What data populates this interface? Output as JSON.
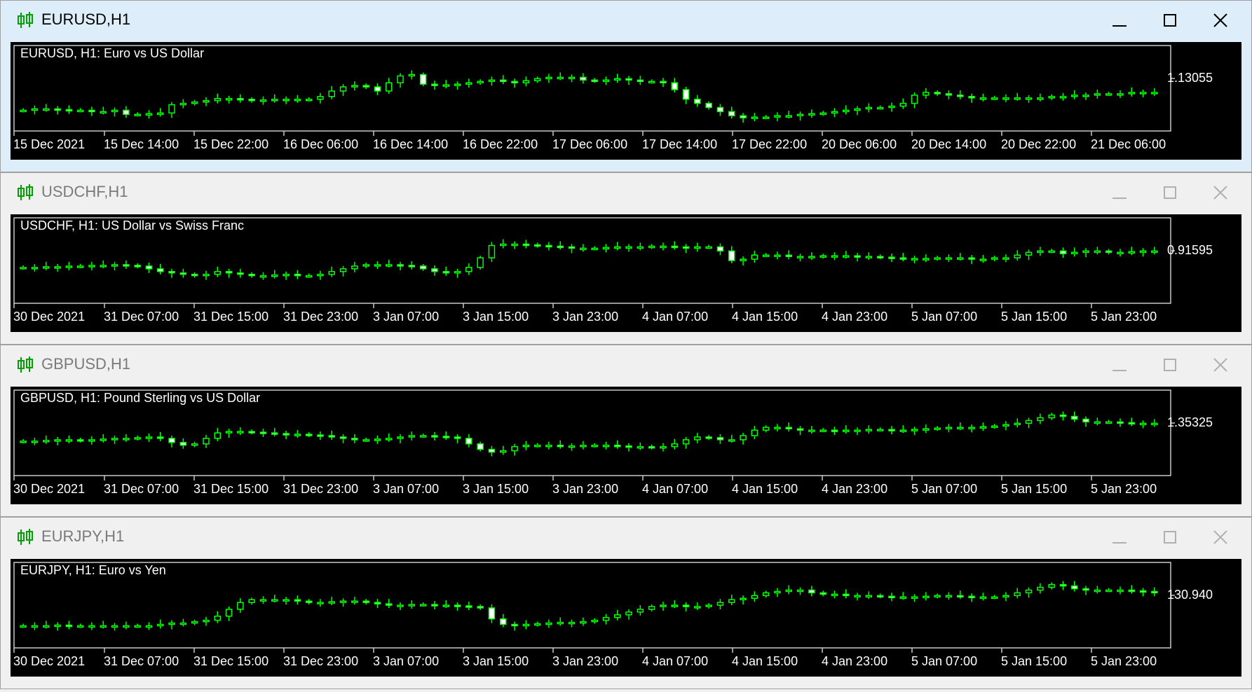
{
  "accent_candle_color": "#00ff00",
  "background_color": "#000000",
  "windows": [
    {
      "title": "EURUSD,H1",
      "active": true,
      "symbol_label": "EURUSD, H1:  Euro vs US Dollar",
      "price_label": "1.13055",
      "time_labels": [
        "15 Dec 2021",
        "15 Dec 14:00",
        "15 Dec 22:00",
        "16 Dec 06:00",
        "16 Dec 14:00",
        "16 Dec 22:00",
        "17 Dec 06:00",
        "17 Dec 14:00",
        "17 Dec 22:00",
        "20 Dec 06:00",
        "20 Dec 14:00",
        "20 Dec 22:00",
        "21 Dec 06:00"
      ],
      "controls": [
        "minimize-icon",
        "maximize-icon",
        "close-icon"
      ],
      "chart_data": {
        "type": "candlestick",
        "series_shape": [
          0.2,
          0.22,
          0.22,
          0.21,
          0.2,
          0.2,
          0.18,
          0.18,
          0.2,
          0.14,
          0.14,
          0.15,
          0.16,
          0.28,
          0.3,
          0.32,
          0.34,
          0.37,
          0.37,
          0.36,
          0.34,
          0.35,
          0.36,
          0.36,
          0.36,
          0.36,
          0.4,
          0.48,
          0.54,
          0.56,
          0.54,
          0.48,
          0.6,
          0.7,
          0.72,
          0.58,
          0.56,
          0.57,
          0.58,
          0.6,
          0.62,
          0.64,
          0.62,
          0.6,
          0.63,
          0.66,
          0.68,
          0.68,
          0.68,
          0.64,
          0.63,
          0.64,
          0.66,
          0.64,
          0.62,
          0.62,
          0.6,
          0.5,
          0.36,
          0.3,
          0.24,
          0.18,
          0.12,
          0.09,
          0.1,
          0.1,
          0.12,
          0.12,
          0.14,
          0.15,
          0.16,
          0.18,
          0.2,
          0.22,
          0.24,
          0.24,
          0.26,
          0.3,
          0.42,
          0.46,
          0.44,
          0.42,
          0.4,
          0.38,
          0.38,
          0.38,
          0.38,
          0.38,
          0.38,
          0.38,
          0.4,
          0.4,
          0.42,
          0.42,
          0.44,
          0.44,
          0.44,
          0.46,
          0.46,
          0.46
        ],
        "price_marker": "1.13055"
      }
    },
    {
      "title": "USDCHF,H1",
      "active": false,
      "symbol_label": "USDCHF, H1:  US Dollar vs Swiss Franc",
      "price_label": "0.91595",
      "time_labels": [
        "30 Dec 2021",
        "31 Dec 07:00",
        "31 Dec 15:00",
        "31 Dec 23:00",
        "3 Jan 07:00",
        "3 Jan 15:00",
        "3 Jan 23:00",
        "4 Jan 07:00",
        "4 Jan 15:00",
        "4 Jan 23:00",
        "5 Jan 07:00",
        "5 Jan 15:00",
        "5 Jan 23:00"
      ],
      "controls": [
        "minimize-icon",
        "maximize-icon",
        "close-icon"
      ],
      "chart_data": {
        "type": "candlestick",
        "series_shape": [
          0.42,
          0.42,
          0.43,
          0.43,
          0.44,
          0.44,
          0.45,
          0.45,
          0.46,
          0.45,
          0.44,
          0.4,
          0.36,
          0.34,
          0.32,
          0.3,
          0.32,
          0.36,
          0.34,
          0.32,
          0.3,
          0.3,
          0.31,
          0.32,
          0.3,
          0.3,
          0.32,
          0.36,
          0.4,
          0.44,
          0.46,
          0.46,
          0.46,
          0.45,
          0.44,
          0.4,
          0.36,
          0.34,
          0.36,
          0.42,
          0.56,
          0.74,
          0.76,
          0.76,
          0.75,
          0.74,
          0.73,
          0.72,
          0.7,
          0.7,
          0.7,
          0.71,
          0.72,
          0.72,
          0.72,
          0.73,
          0.73,
          0.72,
          0.7,
          0.72,
          0.72,
          0.66,
          0.52,
          0.54,
          0.6,
          0.6,
          0.6,
          0.58,
          0.58,
          0.58,
          0.59,
          0.59,
          0.59,
          0.58,
          0.58,
          0.57,
          0.56,
          0.55,
          0.55,
          0.55,
          0.56,
          0.56,
          0.56,
          0.54,
          0.54,
          0.56,
          0.56,
          0.6,
          0.64,
          0.66,
          0.66,
          0.62,
          0.64,
          0.66,
          0.66,
          0.64,
          0.64,
          0.65,
          0.66,
          0.66
        ],
        "price_marker": "0.91595"
      }
    },
    {
      "title": "GBPUSD,H1",
      "active": false,
      "symbol_label": "GBPUSD, H1:  Pound Sterling vs US Dollar",
      "price_label": "1.35325",
      "time_labels": [
        "30 Dec 2021",
        "31 Dec 07:00",
        "31 Dec 15:00",
        "31 Dec 23:00",
        "3 Jan 07:00",
        "3 Jan 15:00",
        "3 Jan 23:00",
        "4 Jan 07:00",
        "4 Jan 15:00",
        "4 Jan 23:00",
        "5 Jan 07:00",
        "5 Jan 15:00",
        "5 Jan 23:00"
      ],
      "controls": [
        "minimize-icon",
        "maximize-icon",
        "close-icon"
      ],
      "chart_data": {
        "type": "candlestick",
        "series_shape": [
          0.4,
          0.4,
          0.41,
          0.42,
          0.42,
          0.41,
          0.42,
          0.43,
          0.44,
          0.44,
          0.45,
          0.46,
          0.44,
          0.38,
          0.34,
          0.36,
          0.44,
          0.52,
          0.54,
          0.54,
          0.53,
          0.52,
          0.51,
          0.5,
          0.5,
          0.49,
          0.48,
          0.46,
          0.44,
          0.42,
          0.42,
          0.43,
          0.44,
          0.46,
          0.48,
          0.48,
          0.47,
          0.46,
          0.44,
          0.36,
          0.28,
          0.24,
          0.26,
          0.32,
          0.34,
          0.34,
          0.34,
          0.33,
          0.33,
          0.34,
          0.34,
          0.34,
          0.33,
          0.32,
          0.32,
          0.31,
          0.32,
          0.36,
          0.42,
          0.46,
          0.45,
          0.42,
          0.42,
          0.48,
          0.56,
          0.6,
          0.6,
          0.58,
          0.56,
          0.56,
          0.56,
          0.55,
          0.56,
          0.56,
          0.57,
          0.57,
          0.56,
          0.56,
          0.57,
          0.58,
          0.59,
          0.6,
          0.6,
          0.6,
          0.61,
          0.62,
          0.64,
          0.66,
          0.7,
          0.74,
          0.78,
          0.76,
          0.72,
          0.68,
          0.68,
          0.68,
          0.67,
          0.66,
          0.66,
          0.66
        ],
        "price_marker": "1.35325"
      }
    },
    {
      "title": "EURJPY,H1",
      "active": false,
      "symbol_label": "EURJPY, H1:  Euro vs Yen",
      "price_label": "130.940",
      "time_labels": [
        "30 Dec 2021",
        "31 Dec 07:00",
        "31 Dec 15:00",
        "31 Dec 23:00",
        "3 Jan 07:00",
        "3 Jan 15:00",
        "3 Jan 23:00",
        "4 Jan 07:00",
        "4 Jan 15:00",
        "4 Jan 23:00",
        "5 Jan 07:00",
        "5 Jan 15:00",
        "5 Jan 23:00"
      ],
      "controls": [
        "minimize-icon",
        "maximize-icon",
        "close-icon"
      ],
      "chart_data": {
        "type": "candlestick",
        "series_shape": [
          0.22,
          0.22,
          0.22,
          0.23,
          0.22,
          0.22,
          0.22,
          0.22,
          0.22,
          0.22,
          0.22,
          0.22,
          0.24,
          0.26,
          0.26,
          0.28,
          0.3,
          0.36,
          0.46,
          0.56,
          0.6,
          0.6,
          0.6,
          0.6,
          0.58,
          0.56,
          0.56,
          0.57,
          0.58,
          0.58,
          0.56,
          0.54,
          0.52,
          0.52,
          0.53,
          0.53,
          0.52,
          0.52,
          0.51,
          0.5,
          0.48,
          0.32,
          0.24,
          0.22,
          0.24,
          0.25,
          0.26,
          0.27,
          0.27,
          0.28,
          0.3,
          0.34,
          0.38,
          0.42,
          0.46,
          0.5,
          0.52,
          0.52,
          0.5,
          0.5,
          0.52,
          0.56,
          0.6,
          0.62,
          0.66,
          0.7,
          0.72,
          0.74,
          0.74,
          0.7,
          0.68,
          0.68,
          0.66,
          0.66,
          0.66,
          0.65,
          0.64,
          0.64,
          0.64,
          0.65,
          0.66,
          0.66,
          0.65,
          0.64,
          0.64,
          0.64,
          0.66,
          0.7,
          0.74,
          0.78,
          0.82,
          0.8,
          0.76,
          0.74,
          0.74,
          0.74,
          0.74,
          0.73,
          0.72,
          0.7
        ],
        "price_marker": "130.940"
      }
    }
  ]
}
